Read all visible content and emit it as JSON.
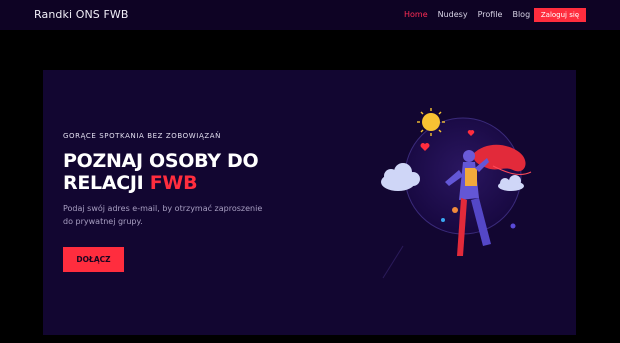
{
  "header": {
    "brand": "Randki ONS FWB",
    "nav": [
      {
        "label": "Home",
        "active": true
      },
      {
        "label": "Nudesy",
        "active": false
      },
      {
        "label": "Profile",
        "active": false
      },
      {
        "label": "Blog",
        "active": false
      }
    ],
    "login_label": "Zaloguj się"
  },
  "hero": {
    "eyebrow": "GORĄCE SPOTKANIA BEZ ZOBOWIĄZAŃ",
    "headline_main": "POZNAJ OSOBY DO RELACJI",
    "headline_accent": "FWB",
    "description": "Podaj swój adres e-mail, by otrzymać zaproszenie do prywatnej grupy.",
    "cta_label": "DOŁĄCZ"
  },
  "colors": {
    "accent": "#ff2d3e",
    "nav_bg": "#0e0324",
    "hero_bg": "#120631",
    "page_bg": "#000000"
  }
}
